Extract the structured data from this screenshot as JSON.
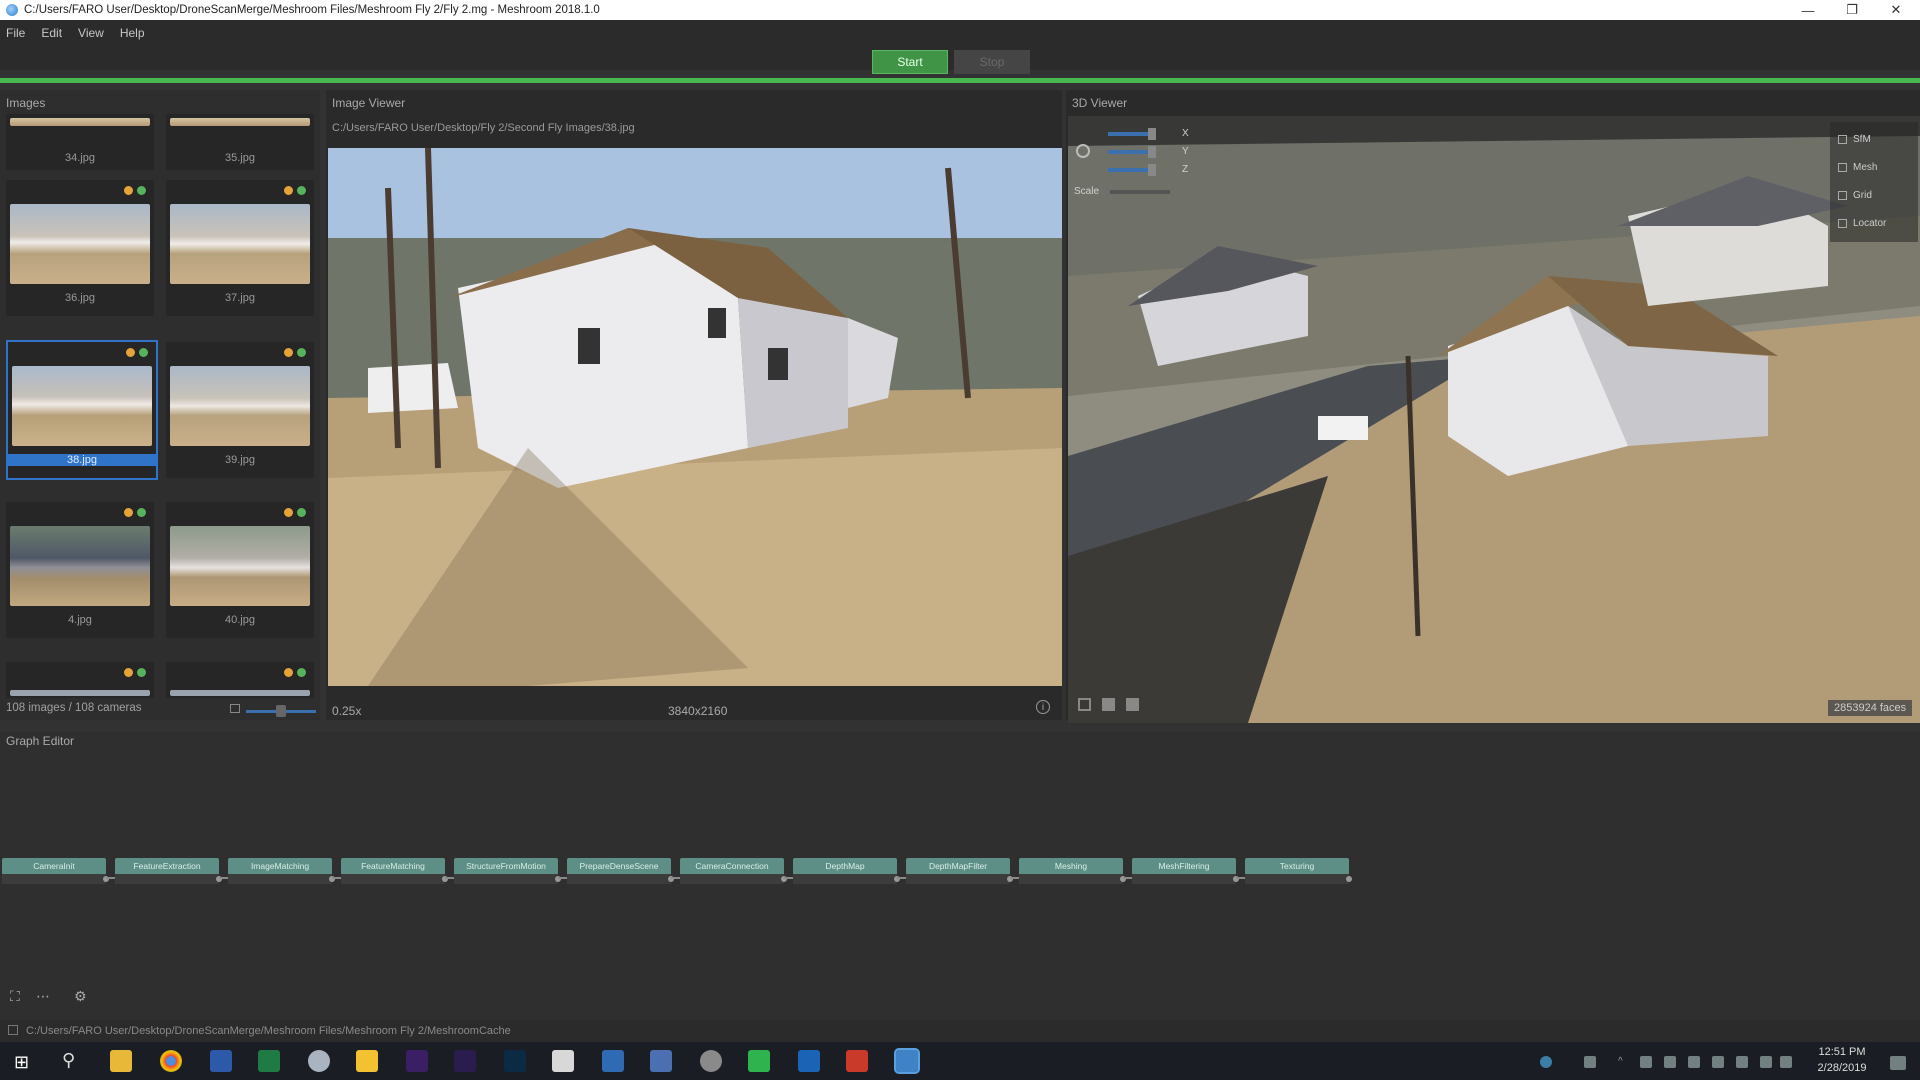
{
  "window": {
    "title": "C:/Users/FARO User/Desktop/DroneScanMerge/Meshroom Files/Meshroom Fly 2/Fly 2.mg - Meshroom 2018.1.0"
  },
  "menu": [
    "File",
    "Edit",
    "View",
    "Help"
  ],
  "toolbar": {
    "start_label": "Start",
    "stop_label": "Stop"
  },
  "images": {
    "title": "Images",
    "items": [
      {
        "name": "34.jpg"
      },
      {
        "name": "35.jpg"
      },
      {
        "name": "36.jpg"
      },
      {
        "name": "37.jpg"
      },
      {
        "name": "38.jpg"
      },
      {
        "name": "39.jpg"
      },
      {
        "name": "4.jpg"
      },
      {
        "name": "40.jpg"
      }
    ],
    "selected": "38.jpg",
    "count": "108 images / 108 cameras"
  },
  "image_viewer": {
    "title": "Image Viewer",
    "path": "C:/Users/FARO User/Desktop/Fly 2/Second Fly Images/38.jpg",
    "zoom": "0.25x",
    "resolution": "3840x2160"
  },
  "viewer_3d": {
    "title": "3D Viewer",
    "axes": [
      "X",
      "Y",
      "Z"
    ],
    "scale_label": "Scale",
    "layers": [
      "SfM",
      "Mesh",
      "Grid",
      "Locator"
    ],
    "faces": "2853924 faces"
  },
  "graph_editor": {
    "title": "Graph Editor",
    "nodes": [
      "CameraInit",
      "FeatureExtraction",
      "ImageMatching",
      "FeatureMatching",
      "StructureFromMotion",
      "PrepareDenseScene",
      "CameraConnection",
      "DepthMap",
      "DepthMapFilter",
      "Meshing",
      "MeshFiltering",
      "Texturing"
    ]
  },
  "statusbar": {
    "path": "C:/Users/FARO User/Desktop/DroneScanMerge/Meshroom Files/Meshroom Fly 2/MeshroomCache"
  },
  "taskbar": {
    "time": "12:51 PM",
    "date": "2/28/2019"
  },
  "colors": {
    "accent_green": "#49b74f",
    "selection_blue": "#2f74c8",
    "node_header": "#5e8f86"
  }
}
